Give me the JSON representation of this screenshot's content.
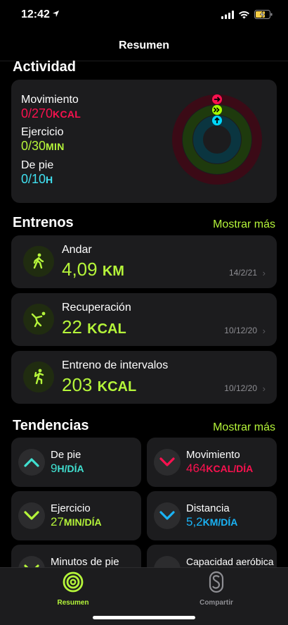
{
  "status": {
    "time": "12:42"
  },
  "nav": {
    "title": "Resumen"
  },
  "activity": {
    "title": "Actividad",
    "move": {
      "label": "Movimiento",
      "value": "0/270",
      "unit": "KCAL",
      "progress": 0
    },
    "exercise": {
      "label": "Ejercicio",
      "value": "0/30",
      "unit": "MIN",
      "progress": 0
    },
    "stand": {
      "label": "De pie",
      "value": "0/10",
      "unit": "H",
      "progress": 0
    },
    "colors": {
      "move": "#fa114f",
      "exercise": "#a6ff00",
      "stand": "#00d7fe"
    }
  },
  "workouts": {
    "title": "Entrenos",
    "more": "Mostrar más",
    "items": [
      {
        "name": "Andar",
        "value": "4,09",
        "unit": "KM",
        "date": "14/2/21",
        "icon": "walking-icon"
      },
      {
        "name": "Recuperación",
        "value": "22",
        "unit": "KCAL",
        "date": "10/12/20",
        "icon": "cooldown-icon"
      },
      {
        "name": "Entreno de intervalos",
        "value": "203",
        "unit": "KCAL",
        "date": "10/12/20",
        "icon": "hiit-icon"
      }
    ]
  },
  "trends": {
    "title": "Tendencias",
    "more": "Mostrar más",
    "items": [
      {
        "name": "De pie",
        "value": "9",
        "unit": "H/DÍA",
        "direction": "up",
        "color": "#40e0d0"
      },
      {
        "name": "Movimiento",
        "value": "464",
        "unit": "KCAL/DÍA",
        "direction": "down",
        "color": "#fa114f"
      },
      {
        "name": "Ejercicio",
        "value": "27",
        "unit": "MIN/DÍA",
        "direction": "down",
        "color": "#b5f53a"
      },
      {
        "name": "Distancia",
        "value": "5,2",
        "unit": "KM/DÍA",
        "direction": "down",
        "color": "#1ab3f5"
      },
      {
        "name": "Minutos de pie",
        "direction": "down",
        "color": "#b5f53a"
      },
      {
        "name": "Capacidad aeróbica"
      }
    ]
  },
  "tabbar": {
    "items": [
      {
        "label": "Resumen",
        "active": true
      },
      {
        "label": "Compartir",
        "active": false
      }
    ]
  }
}
